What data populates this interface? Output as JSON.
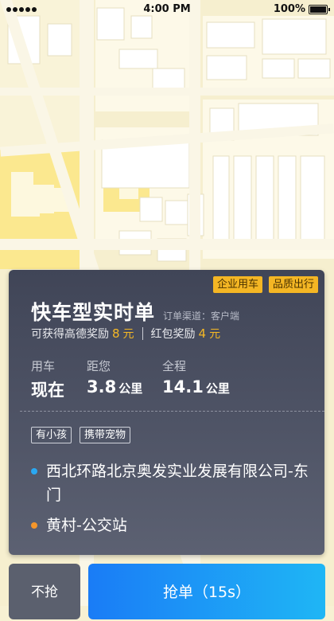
{
  "status_bar": {
    "time": "4:00 PM",
    "battery": "100%"
  },
  "card": {
    "tags_top": [
      "企业用车",
      "品质出行"
    ],
    "title": "快车型实时单",
    "channel": "订单渠道：客户端",
    "reward": {
      "gaode_label": "可获得高德奖励",
      "gaode_value": "8",
      "gaode_unit": "元",
      "redpacket_label": "红包奖励",
      "redpacket_value": "4",
      "redpacket_unit": "元"
    },
    "info": {
      "usecar_label": "用车",
      "usecar_value": "现在",
      "distance_label": "距您",
      "distance_value": "3.8",
      "distance_unit": "公里",
      "total_label": "全程",
      "total_value": "14.1",
      "total_unit": "公里"
    },
    "tags_mid": [
      "有小孩",
      "携带宠物"
    ],
    "from_address": "西北环路北京奥发实业发展有限公司-东门",
    "to_address": "黄村-公交站"
  },
  "buttons": {
    "skip": "不抢",
    "grab": "抢单（15s）"
  },
  "colors": {
    "accent_gold": "#f5b825",
    "button_blue": "#1a7cf6",
    "start_dot": "#2aa8f2",
    "end_dot": "#f5962a"
  }
}
